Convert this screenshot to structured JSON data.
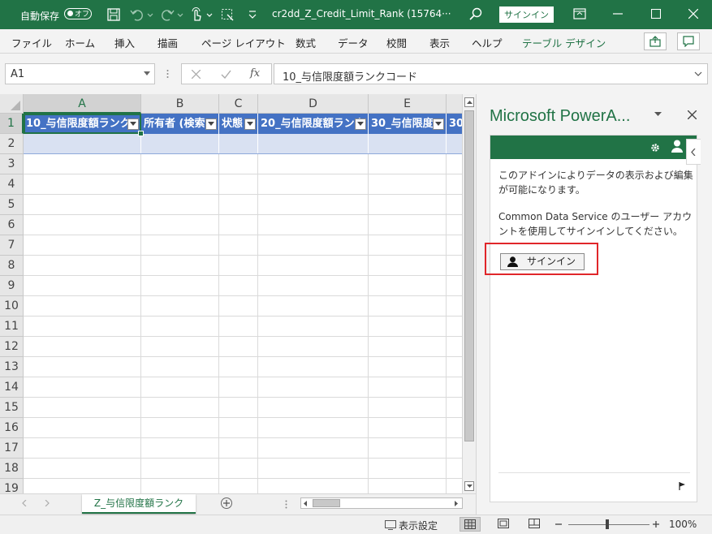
{
  "titlebar": {
    "autosave_label": "自動保存",
    "autosave_state": "オフ",
    "document_title": "cr2dd_Z_Credit_Limit_Rank (15764···",
    "signin": "サインイン"
  },
  "ribbon": {
    "tabs": [
      "ファイル",
      "ホーム",
      "挿入",
      "描画",
      "ページ レイアウト",
      "数式",
      "データ",
      "校閲",
      "表示",
      "ヘルプ",
      "テーブル デザイン"
    ]
  },
  "formula_bar": {
    "name_box": "A1",
    "fx": "fx",
    "value": "10_与信限度額ランクコード"
  },
  "grid": {
    "columns": [
      "A",
      "B",
      "C",
      "D",
      "E"
    ],
    "rows": [
      "1",
      "2",
      "3",
      "4",
      "5",
      "6",
      "7",
      "8",
      "9",
      "10",
      "11",
      "12",
      "13",
      "14",
      "15",
      "16",
      "17",
      "18",
      "19"
    ],
    "headers": [
      "10_与信限度額ランク",
      "所有者 (検索",
      "状態",
      "20_与信限度額ランク",
      "30_与信限度",
      "30"
    ]
  },
  "sheet": {
    "tab": "Z_与信限度額ランク"
  },
  "status": {
    "display_settings": "表示設定",
    "zoom": "100%"
  },
  "pane": {
    "title": "Microsoft PowerA...",
    "text1": "このアドインによりデータの表示および編集が可能になります。",
    "text2": "Common Data Service のユーザー アカウントを使用してサインインしてください。",
    "signin_button": "サインイン"
  },
  "colors": {
    "excel_green": "#217346",
    "table_header": "#4472c4",
    "table_band": "#d9e1f2",
    "highlight_red": "#e0262a"
  }
}
